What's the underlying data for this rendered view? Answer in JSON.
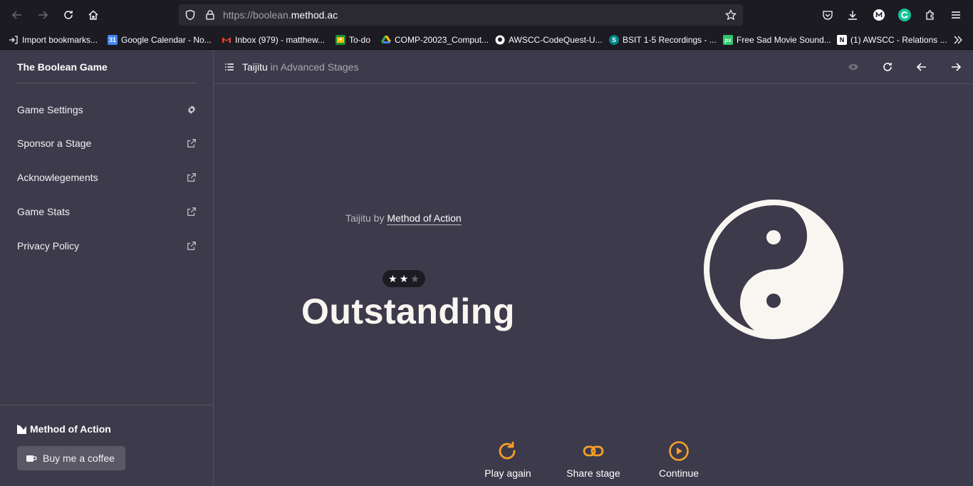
{
  "browser": {
    "url_prefix": "https://boolean.",
    "url_domain": "method.ac",
    "bookmarks": [
      {
        "label": "Import bookmarks...",
        "icon": "import-icon"
      },
      {
        "label": "Google Calendar - No...",
        "icon": "calendar-icon"
      },
      {
        "label": "Inbox (979) - matthew...",
        "icon": "gmail-icon"
      },
      {
        "label": "To-do",
        "icon": "classroom-icon"
      },
      {
        "label": "COMP-20023_Comput...",
        "icon": "drive-icon"
      },
      {
        "label": "AWSCC-CodeQuest-U...",
        "icon": "github-icon"
      },
      {
        "label": "BSIT 1-5 Recordings - ...",
        "icon": "sharepoint-icon"
      },
      {
        "label": "Free Sad Movie Sound...",
        "icon": "pixabay-icon"
      },
      {
        "label": "(1) AWSCC - Relations ...",
        "icon": "notion-icon"
      }
    ]
  },
  "sidebar": {
    "title": "The Boolean Game",
    "items": [
      {
        "label": "Game Settings",
        "icon": "gear-icon"
      },
      {
        "label": "Sponsor a Stage",
        "icon": "external-link-icon"
      },
      {
        "label": "Acknowlegements",
        "icon": "external-link-icon"
      },
      {
        "label": "Game Stats",
        "icon": "external-link-icon"
      },
      {
        "label": "Privacy Policy",
        "icon": "external-link-icon"
      }
    ],
    "brand": "Method of Action",
    "coffee_label": "Buy me a coffee"
  },
  "header": {
    "stage": "Taijitu",
    "context": " in Advanced Stages"
  },
  "result": {
    "credit_prefix": "Taijitu by ",
    "credit_author": "Method of Action",
    "stars_earned": 2,
    "stars_total": 3,
    "rating": "Outstanding"
  },
  "actions": {
    "play_again": "Play again",
    "share": "Share stage",
    "continue": "Continue"
  },
  "colors": {
    "background": "#3d3a4b",
    "accent": "#f59f28",
    "shape": "#f9f6f2"
  }
}
